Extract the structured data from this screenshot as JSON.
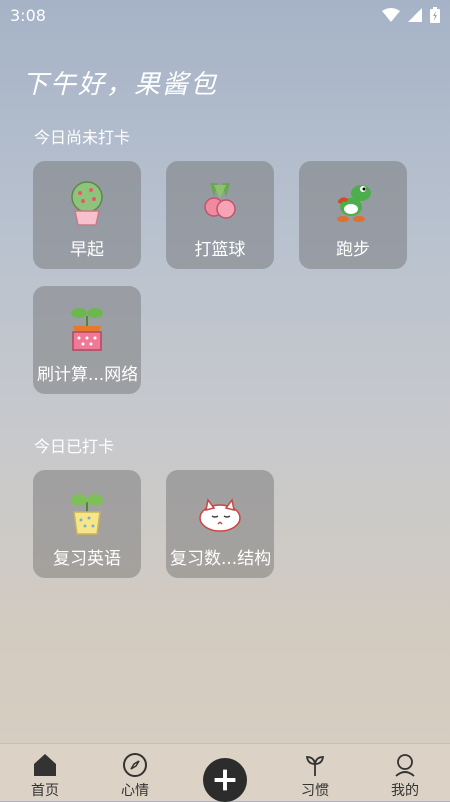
{
  "status": {
    "time": "3:08"
  },
  "greeting": "下午好，果酱包",
  "sections": {
    "pending_title": "今日尚未打卡",
    "done_title": "今日已打卡"
  },
  "pending": [
    {
      "label": "早起",
      "icon": "tree-pot-icon"
    },
    {
      "label": "打篮球",
      "icon": "radish-icon"
    },
    {
      "label": "跑步",
      "icon": "yoshi-icon"
    },
    {
      "label": "刷计算...网络",
      "icon": "sprout-basket-icon"
    }
  ],
  "done": [
    {
      "label": "复习英语",
      "icon": "plant-pot-icon"
    },
    {
      "label": "复习数...结构",
      "icon": "sleeping-cat-icon"
    }
  ],
  "nav": {
    "home": "首页",
    "mood": "心情",
    "habit": "习惯",
    "mine": "我的"
  }
}
